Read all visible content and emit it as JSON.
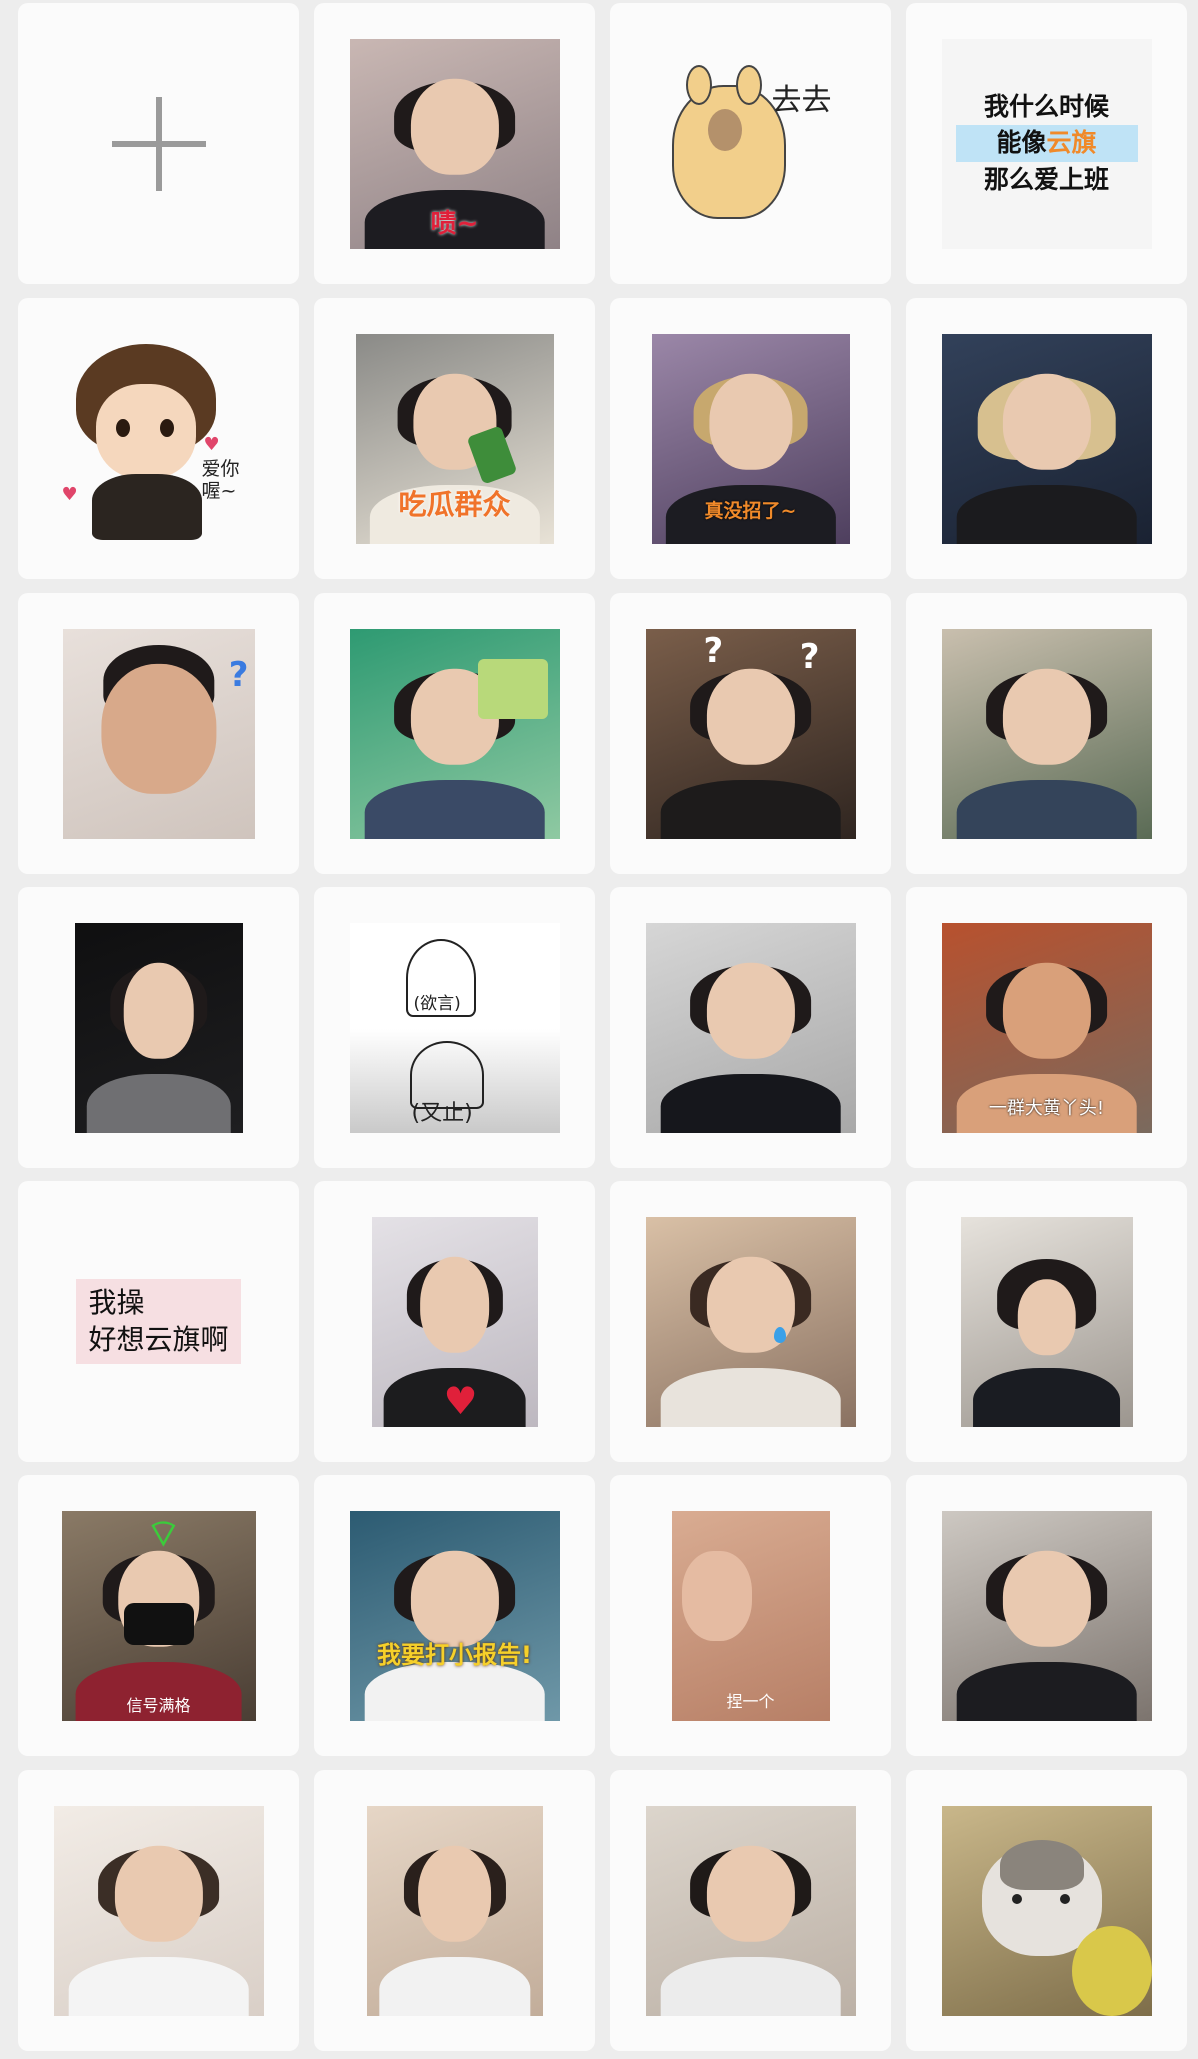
{
  "add_button": {
    "icon": "plus-icon"
  },
  "captions": {
    "c1": "啧~",
    "c2_speech": "去去",
    "c3_line1": "我什么时候",
    "c3_line2_a": "能像",
    "c3_line2_b": "云旗",
    "c3_line3": "那么爱上班",
    "c4_speech": "爱你\n喔~",
    "c5": "吃瓜群众",
    "c6": "真没招了~",
    "c13_top": "(欲言)",
    "c13_bottom": "(又止)",
    "c15": "一群大黄丫头!",
    "c16_line1": "我操",
    "c16_line2": "好想云旗啊",
    "c20": "信号满格",
    "c21": "我要打小报告!",
    "c22": "捏一个"
  },
  "colors": {
    "background": "#ededed",
    "cell": "#fbfbfb",
    "highlight_blue": "#bfe3f6",
    "caption_orange": "#f08a2a"
  }
}
